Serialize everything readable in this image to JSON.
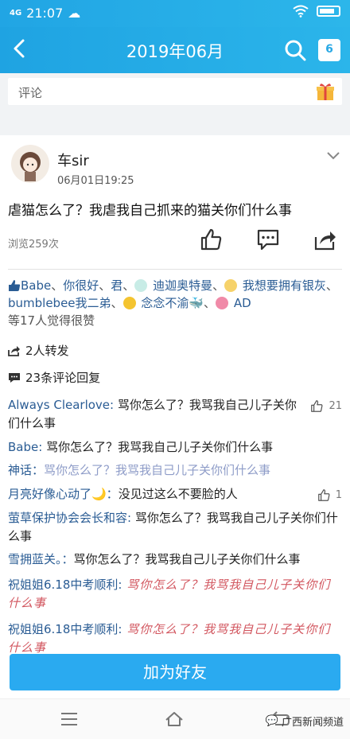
{
  "status": {
    "network": "4G",
    "time": "21:07"
  },
  "nav": {
    "title": "2019年06月",
    "calendar_day": "6"
  },
  "comment_bar": {
    "placeholder": "评论"
  },
  "post": {
    "author": "车sir",
    "time": "06月01日19:25",
    "text": "虐猫怎么了？我虐我自己抓来的猫关你们什么事",
    "views": "浏览259次"
  },
  "likes": {
    "names": [
      "Babe",
      "你很好",
      "君",
      "迪迦奥特曼",
      "我想要拥有银灰",
      "bumblebee我二弟",
      "念念不渝",
      "AD"
    ],
    "summary": "等17人觉得很赞"
  },
  "shares": "2人转发",
  "comments_count": "23条评论回复",
  "comments": [
    {
      "name": "Always Clearlove:",
      "text": " 骂你怎么了？我骂我自己儿子关你们什么事",
      "likes": "21"
    },
    {
      "name": "Babe:",
      "text": " 骂你怎么了？我骂我自己儿子关你们什么事"
    },
    {
      "name": "神话：",
      "text": "骂你怎么了？我骂我自己儿子关你们什么事"
    },
    {
      "name": "月亮好像心动了🌙：",
      "text": "没见过这么不要脸的人",
      "likes": "1"
    },
    {
      "name": "萤草保护协会会长和容:",
      "text": " 骂你怎么了？我骂我自己儿子关你们什么事"
    },
    {
      "name": "雪拥蓝关。：",
      "text": "骂你怎么了？我骂我自己儿子关你们什么事"
    },
    {
      "name": "祝姐姐6.18中考顺利:",
      "text": " 骂你怎么了？我骂我自己儿子关你们什么事"
    },
    {
      "name": "祝姐姐6.18中考顺利:",
      "text": " 骂你怎么了？我骂我自己儿子关你们什么事"
    }
  ],
  "add_friend": "加为好友",
  "watermark": "广西新闻频道",
  "colors": {
    "header": "#2aaee8",
    "link": "#2a5c94",
    "button": "#2aaaf0"
  },
  "icons": [
    "back-icon",
    "search-icon",
    "calendar-icon",
    "gift-icon",
    "chevron-down-icon",
    "thumb-up-icon",
    "comment-icon",
    "share-icon",
    "menu-icon",
    "home-icon",
    "back-nav-icon"
  ]
}
